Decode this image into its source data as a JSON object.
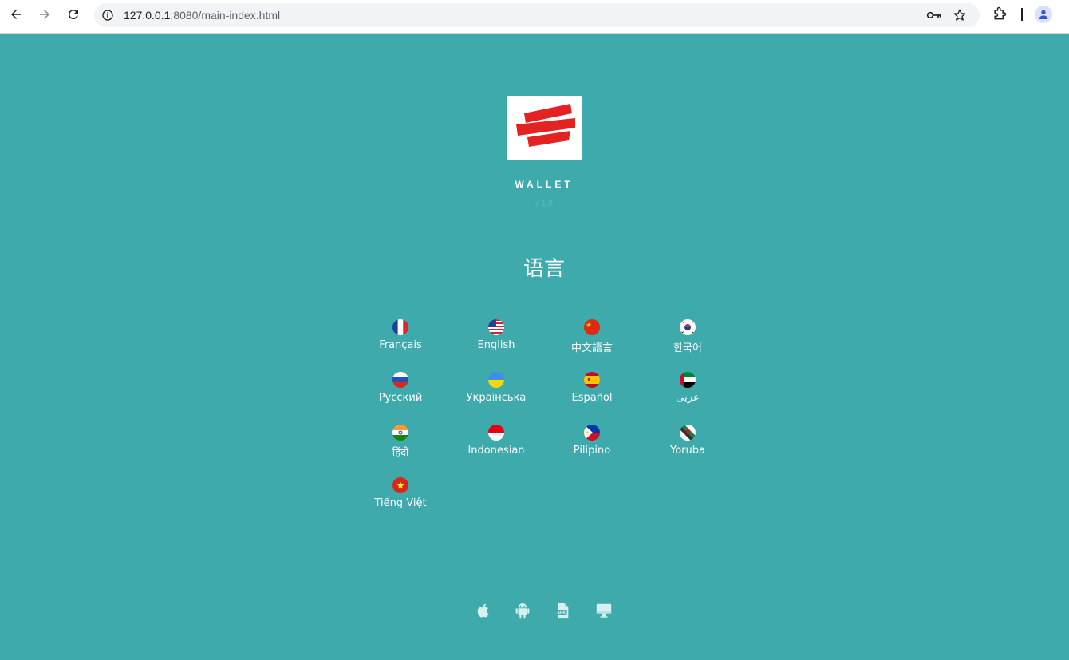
{
  "browser": {
    "url_host": "127.0.0.1",
    "url_path": ":8080/main-index.html"
  },
  "app": {
    "brand": "WALLET",
    "version": "v 1.0",
    "section_title": "语言"
  },
  "languages": [
    {
      "label": "Français",
      "flag": "france-flag-icon"
    },
    {
      "label": "English",
      "flag": "usa-flag-icon"
    },
    {
      "label": "中文語言",
      "flag": "china-flag-icon"
    },
    {
      "label": "한국어",
      "flag": "korea-flag-icon"
    },
    {
      "label": "Русский",
      "flag": "russia-flag-icon"
    },
    {
      "label": "Українська",
      "flag": "ukraine-flag-icon"
    },
    {
      "label": "Español",
      "flag": "spain-flag-icon"
    },
    {
      "label": "عربى",
      "flag": "uae-flag-icon"
    },
    {
      "label": "हिंदी",
      "flag": "india-flag-icon"
    },
    {
      "label": "Indonesian",
      "flag": "indonesia-flag-icon"
    },
    {
      "label": "Pilipino",
      "flag": "philippines-flag-icon"
    },
    {
      "label": "Yoruba",
      "flag": "yoruba-flag-icon"
    },
    {
      "label": "Tiếng Việt",
      "flag": "vietnam-flag-icon"
    }
  ],
  "footer": [
    "apple-icon",
    "android-icon",
    "apk-icon",
    "desktop-icon"
  ],
  "colors": {
    "background": "#3eaaab",
    "logo_red": "#e52222"
  }
}
